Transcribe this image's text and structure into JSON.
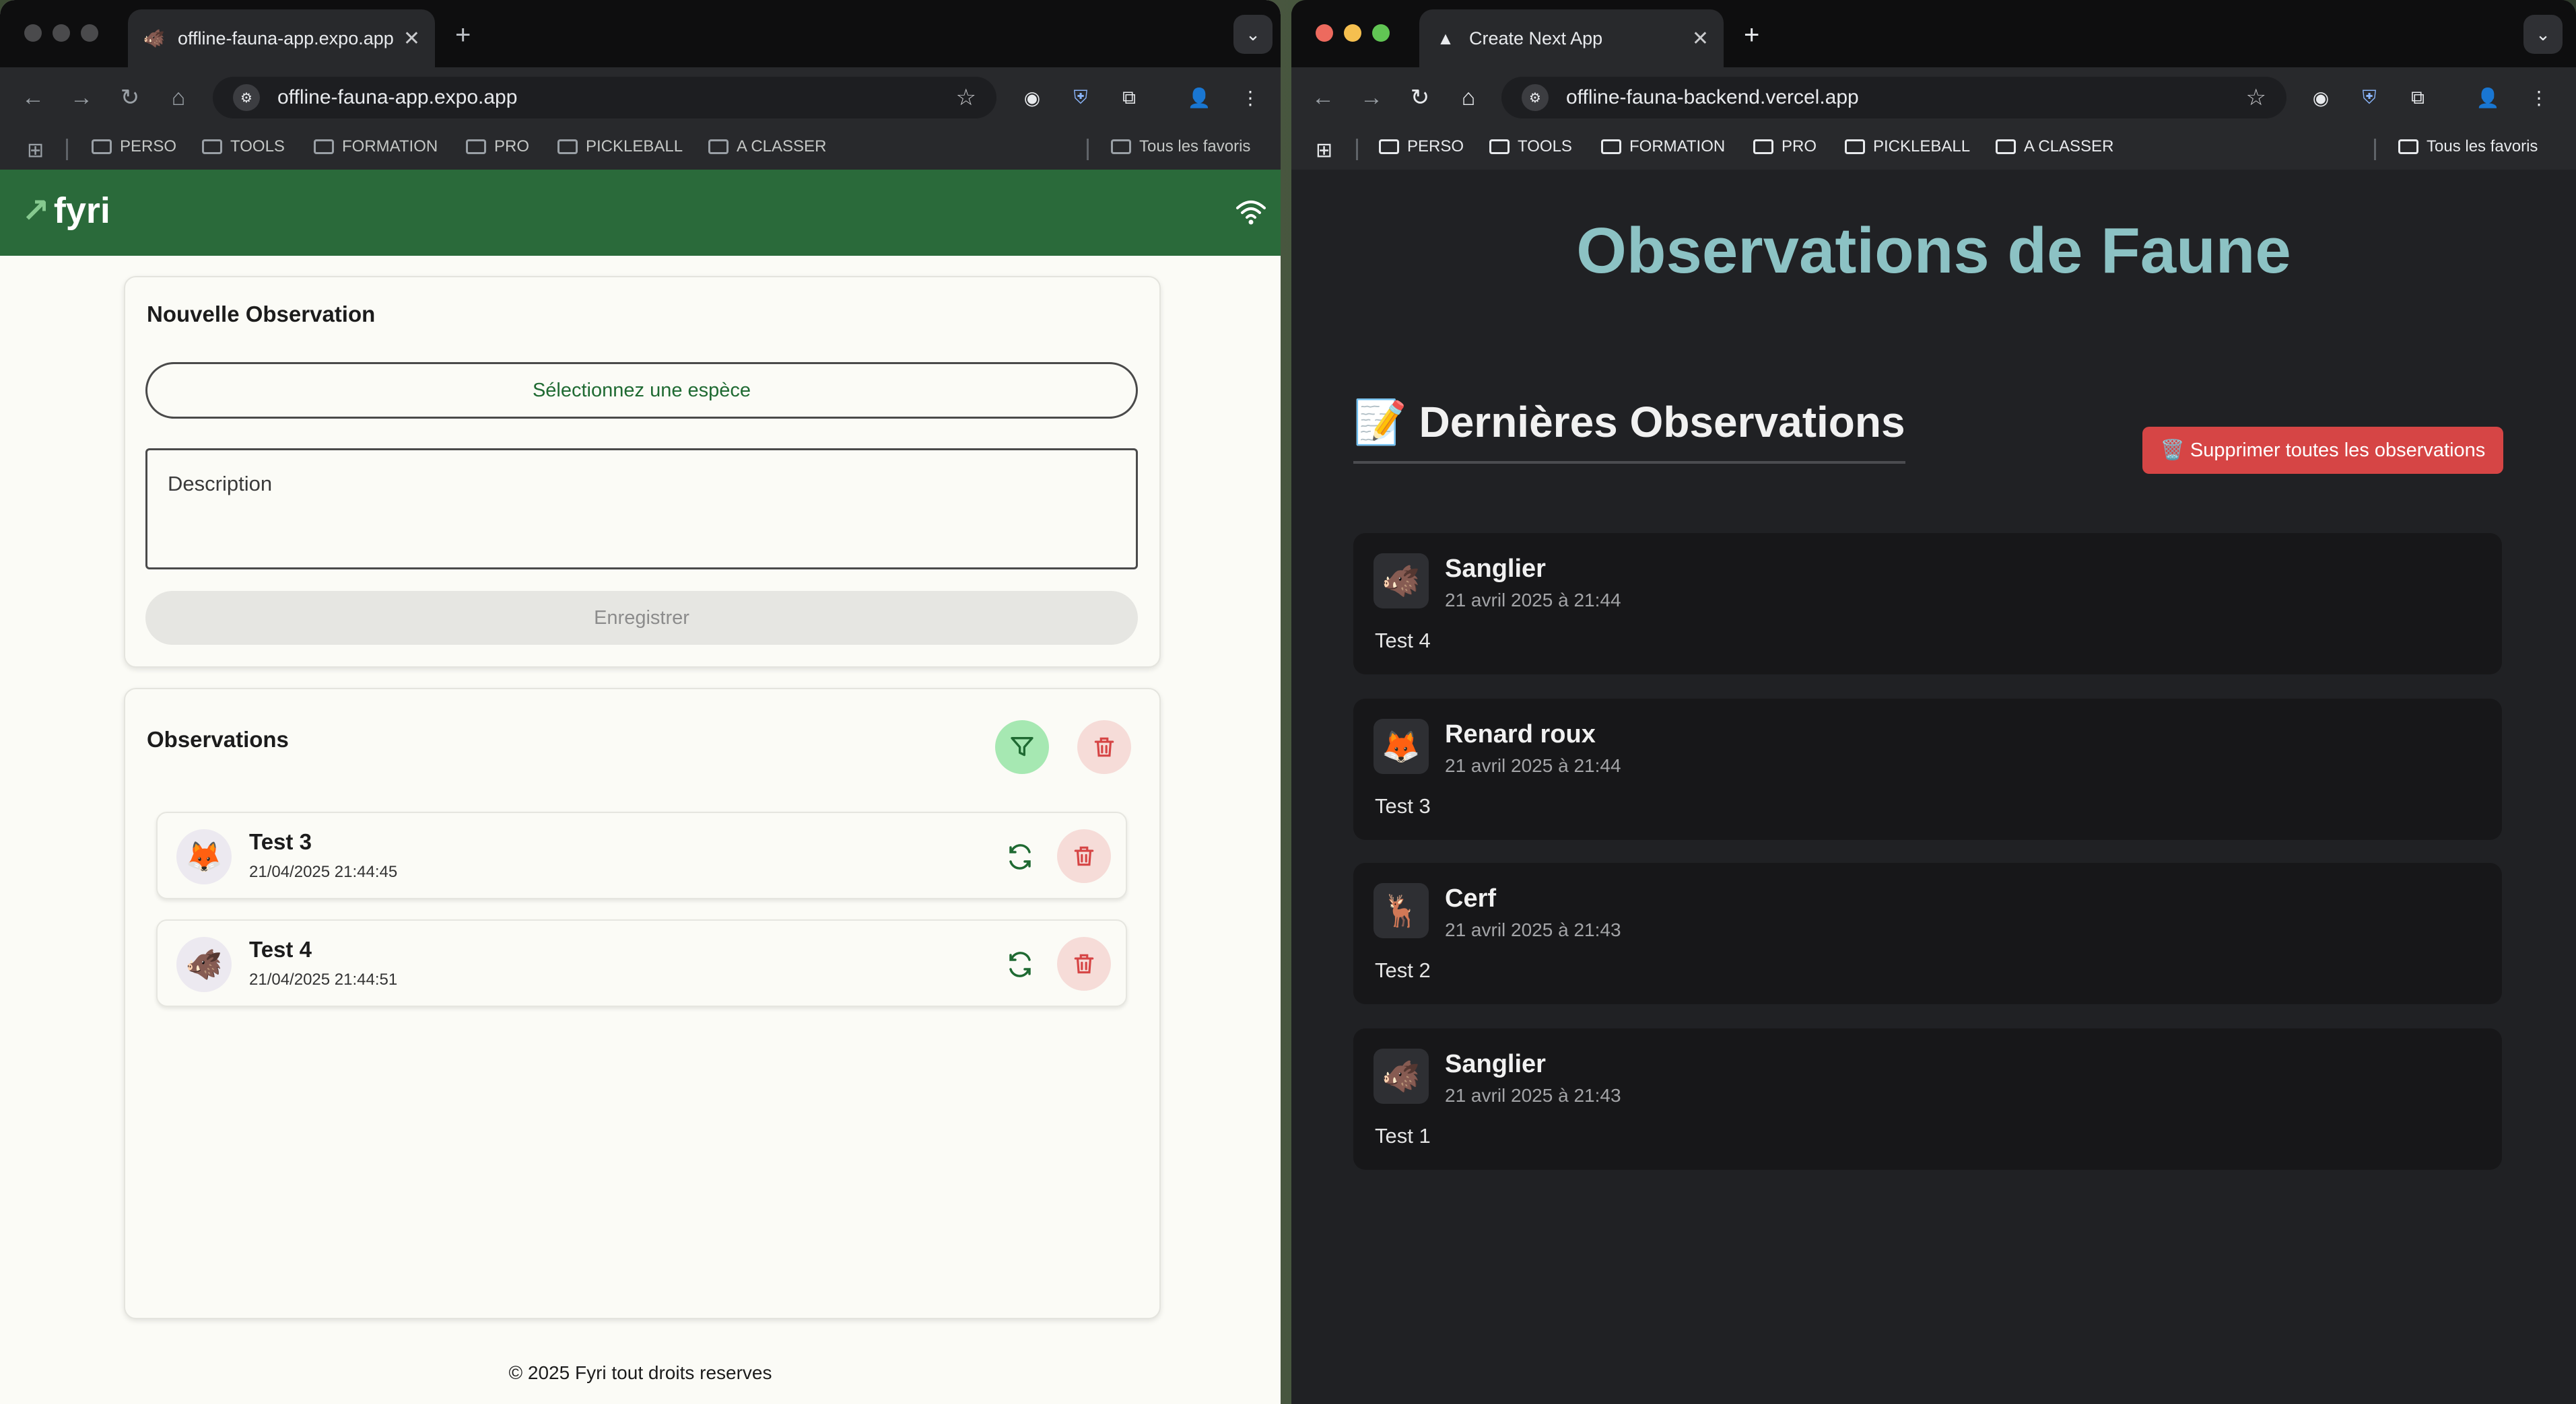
{
  "left_window": {
    "tab_title": "offline-fauna-app.expo.app",
    "url": "offline-fauna-app.expo.app",
    "bookmarks": [
      "PERSO",
      "TOOLS",
      "FORMATION",
      "PRO",
      "PICKLEBALL",
      "A CLASSER"
    ],
    "all_bookmarks": "Tous les favoris",
    "app": {
      "logo": "fyri",
      "new_obs_title": "Nouvelle Observation",
      "select_species": "Sélectionnez une espèce",
      "description_placeholder": "Description",
      "save_label": "Enregistrer",
      "observations_title": "Observations",
      "rows": [
        {
          "title": "Test 3",
          "date": "21/04/2025 21:44:45",
          "emoji": "🦊"
        },
        {
          "title": "Test 4",
          "date": "21/04/2025 21:44:51",
          "emoji": "🐗"
        }
      ],
      "footer": "© 2025 Fyri tout droits reserves"
    }
  },
  "right_window": {
    "tab_title": "Create Next App",
    "url": "offline-fauna-backend.vercel.app",
    "bookmarks": [
      "PERSO",
      "TOOLS",
      "FORMATION",
      "PRO",
      "PICKLEBALL",
      "A CLASSER"
    ],
    "all_bookmarks": "Tous les favoris",
    "app": {
      "title": "Observations de Faune",
      "section_title": "📝 Dernières Observations",
      "delete_all": "🗑️ Supprimer toutes les observations",
      "observations": [
        {
          "species": "Sanglier",
          "date": "21 avril 2025 à 21:44",
          "text": "Test 4",
          "emoji": "🐗"
        },
        {
          "species": "Renard roux",
          "date": "21 avril 2025 à 21:44",
          "text": "Test 3",
          "emoji": "🦊"
        },
        {
          "species": "Cerf",
          "date": "21 avril 2025 à 21:43",
          "text": "Test 2",
          "emoji": "🦌"
        },
        {
          "species": "Sanglier",
          "date": "21 avril 2025 à 21:43",
          "text": "Test 1",
          "emoji": "🐗"
        }
      ]
    }
  },
  "colors": {
    "brand_green": "#2a6a3a",
    "hero_teal": "#8cc2c4",
    "danger_red": "#d64545"
  }
}
